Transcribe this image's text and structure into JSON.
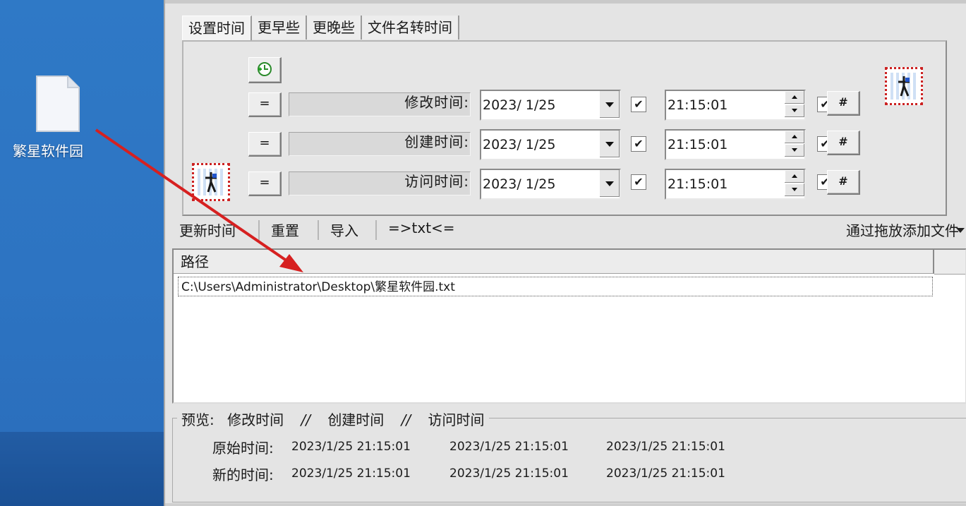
{
  "desktop": {
    "file_label": "繁星软件园",
    "icon": "text-file-icon"
  },
  "tabs": [
    {
      "label": "设置时间"
    },
    {
      "label": "更早些"
    },
    {
      "label": "更晚些"
    },
    {
      "label": "文件名转时间"
    }
  ],
  "time_rows": [
    {
      "label": "修改时间:",
      "date": "2023/  1/25",
      "date_checked": "✔",
      "time": "21:15:01",
      "time_checked": "✔",
      "eq": "=",
      "hash": "#"
    },
    {
      "label": "创建时间:",
      "date": "2023/  1/25",
      "date_checked": "✔",
      "time": "21:15:01",
      "time_checked": "✔",
      "eq": "=",
      "hash": "#"
    },
    {
      "label": "访问时间:",
      "date": "2023/  1/25",
      "date_checked": "✔",
      "time": "21:15:01",
      "time_checked": "✔",
      "eq": "=",
      "hash": "#"
    }
  ],
  "toolbar": {
    "update": "更新时间",
    "reset": "重置",
    "import": "导入",
    "txt": "=>txt<=",
    "drag_add": "通过拖放添加文件"
  },
  "list": {
    "header_path": "路径",
    "rows": [
      {
        "path": "C:\\Users\\Administrator\\Desktop\\繁星软件园.txt"
      }
    ]
  },
  "preview": {
    "legend_label": "预览:",
    "col_modify": "修改时间",
    "col_create": "创建时间",
    "col_access": "访问时间",
    "slash": "//",
    "original_label": "原始时间:",
    "new_label": "新的时间:",
    "original": [
      "2023/1/25 21:15:01",
      "2023/1/25 21:15:01",
      "2023/1/25 21:15:01"
    ],
    "new": [
      "2023/1/25 21:15:01",
      "2023/1/25 21:15:01",
      "2023/1/25 21:15:01"
    ]
  },
  "colors": {
    "desktop_blue": "#2f79c6",
    "arrow_red": "#d62020"
  }
}
